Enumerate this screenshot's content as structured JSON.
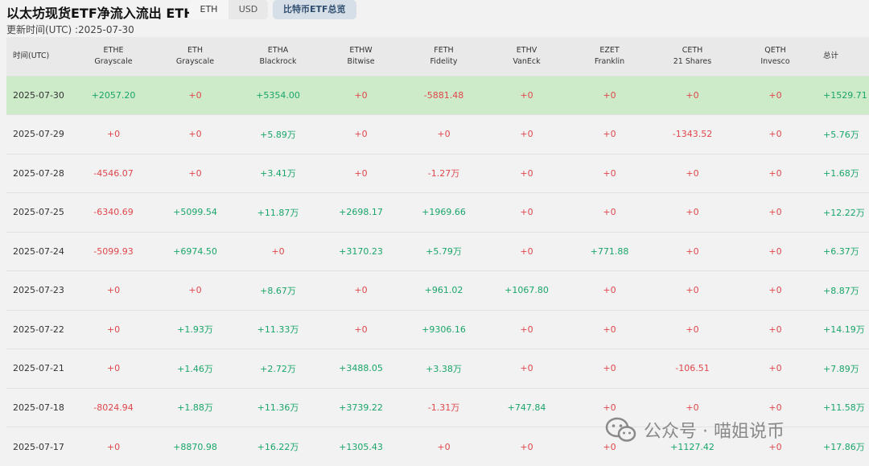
{
  "header": {
    "title": "以太坊现货ETF净流入流出 ETH",
    "currency_options": [
      "ETH",
      "USD"
    ],
    "active_currency": "ETH",
    "overview_button": "比特币ETF总览",
    "updated": "更新时间(UTC) :2025-07-30"
  },
  "table": {
    "time_header": "时间(UTC)",
    "total_header": "总计",
    "columns": [
      {
        "ticker": "ETHE",
        "issuer": "Grayscale"
      },
      {
        "ticker": "ETH",
        "issuer": "Grayscale"
      },
      {
        "ticker": "ETHA",
        "issuer": "Blackrock"
      },
      {
        "ticker": "ETHW",
        "issuer": "Bitwise"
      },
      {
        "ticker": "FETH",
        "issuer": "Fidelity"
      },
      {
        "ticker": "ETHV",
        "issuer": "VanEck"
      },
      {
        "ticker": "EZET",
        "issuer": "Franklin"
      },
      {
        "ticker": "CETH",
        "issuer": "21 Shares"
      },
      {
        "ticker": "QETH",
        "issuer": "Invesco"
      }
    ],
    "rows": [
      {
        "date": "2025-07-30",
        "highlight": true,
        "values": [
          "+2057.20",
          "+0",
          "+5354.00",
          "+0",
          "-5881.48",
          "+0",
          "+0",
          "+0",
          "+0"
        ],
        "total": "+1529.71"
      },
      {
        "date": "2025-07-29",
        "highlight": false,
        "values": [
          "+0",
          "+0",
          "+5.89万",
          "+0",
          "+0",
          "+0",
          "+0",
          "-1343.52",
          "+0"
        ],
        "total": "+5.76万"
      },
      {
        "date": "2025-07-28",
        "highlight": false,
        "values": [
          "-4546.07",
          "+0",
          "+3.41万",
          "+0",
          "-1.27万",
          "+0",
          "+0",
          "+0",
          "+0"
        ],
        "total": "+1.68万"
      },
      {
        "date": "2025-07-25",
        "highlight": false,
        "values": [
          "-6340.69",
          "+5099.54",
          "+11.87万",
          "+2698.17",
          "+1969.66",
          "+0",
          "+0",
          "+0",
          "+0"
        ],
        "total": "+12.22万"
      },
      {
        "date": "2025-07-24",
        "highlight": false,
        "values": [
          "-5099.93",
          "+6974.50",
          "+0",
          "+3170.23",
          "+5.79万",
          "+0",
          "+771.88",
          "+0",
          "+0"
        ],
        "total": "+6.37万"
      },
      {
        "date": "2025-07-23",
        "highlight": false,
        "values": [
          "+0",
          "+0",
          "+8.67万",
          "+0",
          "+961.02",
          "+1067.80",
          "+0",
          "+0",
          "+0"
        ],
        "total": "+8.87万"
      },
      {
        "date": "2025-07-22",
        "highlight": false,
        "values": [
          "+0",
          "+1.93万",
          "+11.33万",
          "+0",
          "+9306.16",
          "+0",
          "+0",
          "+0",
          "+0"
        ],
        "total": "+14.19万"
      },
      {
        "date": "2025-07-21",
        "highlight": false,
        "values": [
          "+0",
          "+1.46万",
          "+2.72万",
          "+3488.05",
          "+3.38万",
          "+0",
          "+0",
          "-106.51",
          "+0"
        ],
        "total": "+7.89万"
      },
      {
        "date": "2025-07-18",
        "highlight": false,
        "values": [
          "-8024.94",
          "+1.88万",
          "+11.36万",
          "+3739.22",
          "-1.31万",
          "+747.84",
          "+0",
          "+0",
          "+0"
        ],
        "total": "+11.58万"
      },
      {
        "date": "2025-07-17",
        "highlight": false,
        "values": [
          "+0",
          "+8870.98",
          "+16.22万",
          "+1305.43",
          "+0",
          "+0",
          "+0",
          "+1127.42",
          "+0"
        ],
        "total": "+17.86万"
      }
    ]
  },
  "watermark": {
    "text": "公众号 · 喵姐说币",
    "icon": "wechat-icon"
  },
  "colors": {
    "positive": "#1aa56a",
    "negative": "#e0474c",
    "highlight_row": "#cdeac9"
  }
}
